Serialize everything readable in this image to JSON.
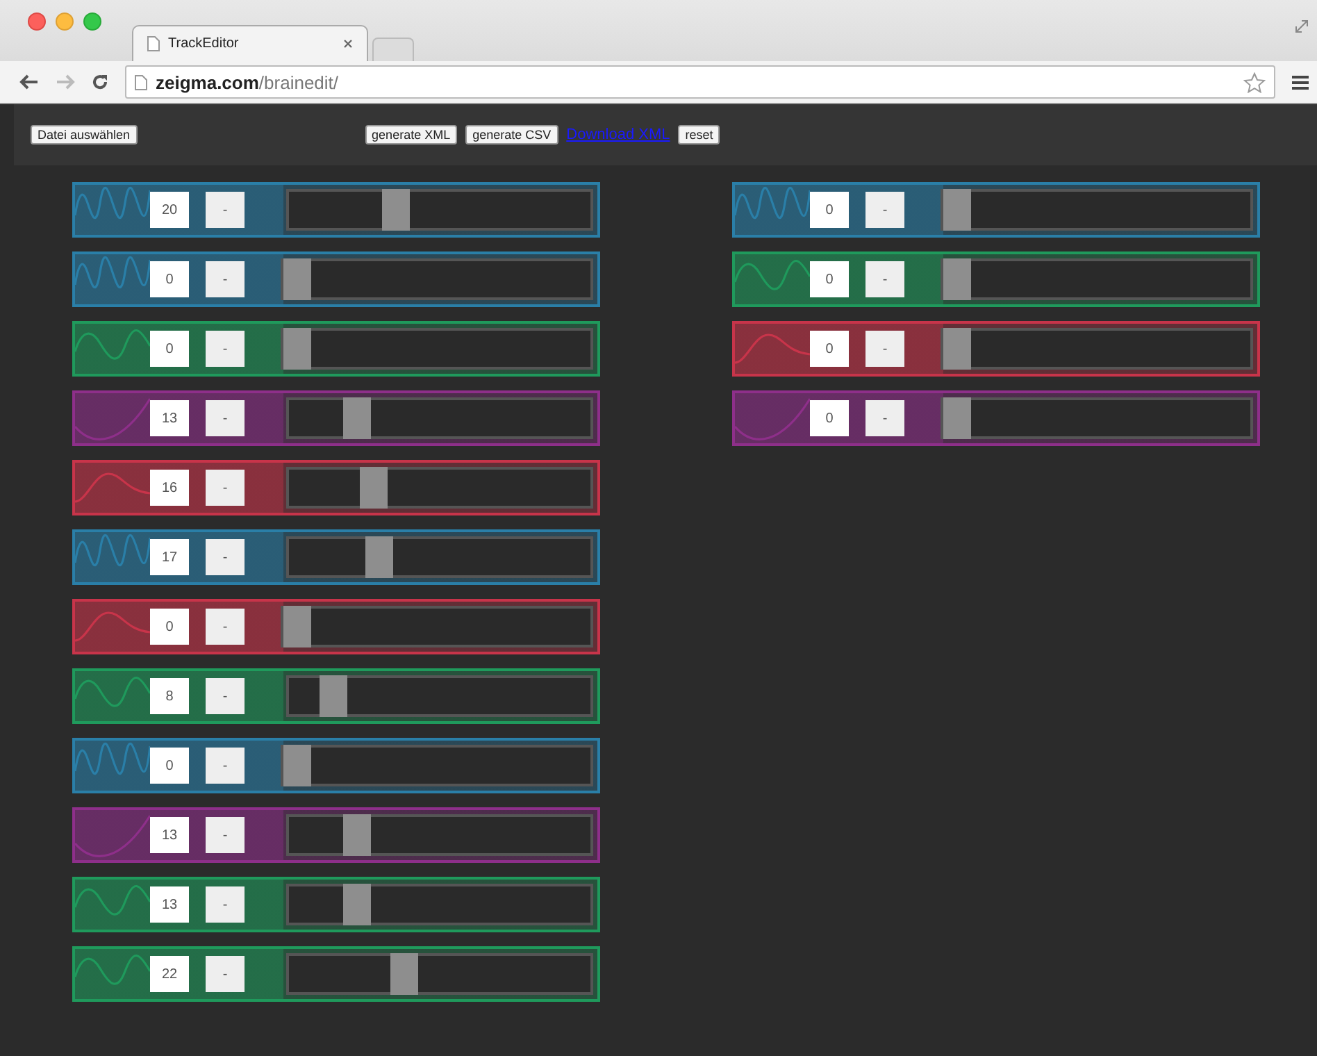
{
  "browser": {
    "tab_title": "TrackEditor",
    "url_domain": "zeigma.com",
    "url_path": "/brainedit/"
  },
  "toolbar": {
    "file_button": "Datei auswählen",
    "buttons": [
      "generate XML",
      "generate CSV"
    ],
    "link": "Download XML",
    "reset_button": "reset"
  },
  "columns": [
    {
      "tracks": [
        {
          "kind": "fast",
          "color": "#2a7fa8",
          "value": "20",
          "button": "-",
          "level": 0.34
        },
        {
          "kind": "fast",
          "color": "#2a7fa8",
          "value": "0",
          "button": "-",
          "level": 0
        },
        {
          "kind": "medium",
          "color": "#1f9a5c",
          "value": "0",
          "button": "-",
          "level": 0
        },
        {
          "kind": "slowest",
          "color": "#8e2f8a",
          "value": "13",
          "button": "-",
          "level": 0.2
        },
        {
          "kind": "slow",
          "color": "#c8344a",
          "value": "16",
          "button": "-",
          "level": 0.26
        },
        {
          "kind": "fast",
          "color": "#2a7fa8",
          "value": "17",
          "button": "-",
          "level": 0.28
        },
        {
          "kind": "slow",
          "color": "#c8344a",
          "value": "0",
          "button": "-",
          "level": 0
        },
        {
          "kind": "medium",
          "color": "#1f9a5c",
          "value": "8",
          "button": "-",
          "level": 0.11
        },
        {
          "kind": "fast",
          "color": "#2a7fa8",
          "value": "0",
          "button": "-",
          "level": 0
        },
        {
          "kind": "slowest",
          "color": "#8e2f8a",
          "value": "13",
          "button": "-",
          "level": 0.2
        },
        {
          "kind": "medium",
          "color": "#1f9a5c",
          "value": "13",
          "button": "-",
          "level": 0.2
        },
        {
          "kind": "medium",
          "color": "#1f9a5c",
          "value": "22",
          "button": "-",
          "level": 0.37
        }
      ]
    },
    {
      "tracks": [
        {
          "kind": "fast",
          "color": "#2a7fa8",
          "value": "0",
          "button": "-",
          "level": 0
        },
        {
          "kind": "medium",
          "color": "#1f9a5c",
          "value": "0",
          "button": "-",
          "level": 0
        },
        {
          "kind": "slow",
          "color": "#c8344a",
          "value": "0",
          "button": "-",
          "level": 0
        },
        {
          "kind": "slowest",
          "color": "#8e2f8a",
          "value": "0",
          "button": "-",
          "level": 0
        }
      ]
    }
  ]
}
